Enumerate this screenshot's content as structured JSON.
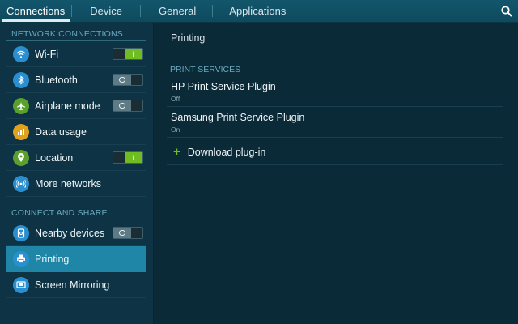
{
  "tabs": [
    {
      "label": "Connections",
      "active": true
    },
    {
      "label": "Device",
      "active": false
    },
    {
      "label": "General",
      "active": false
    },
    {
      "label": "Applications",
      "active": false
    }
  ],
  "search_icon": "search-icon",
  "sidebar": {
    "network_header": "NETWORK CONNECTIONS",
    "share_header": "CONNECT AND SHARE",
    "network_items": [
      {
        "label": "Wi-Fi",
        "icon": "wifi-icon",
        "toggle": "on",
        "toggle_text": "I"
      },
      {
        "label": "Bluetooth",
        "icon": "bluetooth-icon",
        "toggle": "off"
      },
      {
        "label": "Airplane mode",
        "icon": "airplane-icon",
        "toggle": "off"
      },
      {
        "label": "Data usage",
        "icon": "data-usage-icon",
        "toggle": null
      },
      {
        "label": "Location",
        "icon": "location-icon",
        "toggle": "on",
        "toggle_text": "I"
      },
      {
        "label": "More networks",
        "icon": "more-networks-icon",
        "toggle": null
      }
    ],
    "share_items": [
      {
        "label": "Nearby devices",
        "icon": "nearby-devices-icon",
        "toggle": "off"
      },
      {
        "label": "Printing",
        "icon": "printer-icon",
        "toggle": null,
        "selected": true
      },
      {
        "label": "Screen Mirroring",
        "icon": "screen-mirroring-icon",
        "toggle": null
      }
    ]
  },
  "main": {
    "title": "Printing",
    "services_header": "PRINT SERVICES",
    "services": [
      {
        "name": "HP Print Service Plugin",
        "status": "Off"
      },
      {
        "name": "Samsung Print Service Plugin",
        "status": "On"
      }
    ],
    "download_label": "Download plug-in"
  },
  "colors": {
    "accent_selected": "#1f86a8",
    "toggle_on": "#6fbd23",
    "section_header": "#6aa9bf"
  }
}
